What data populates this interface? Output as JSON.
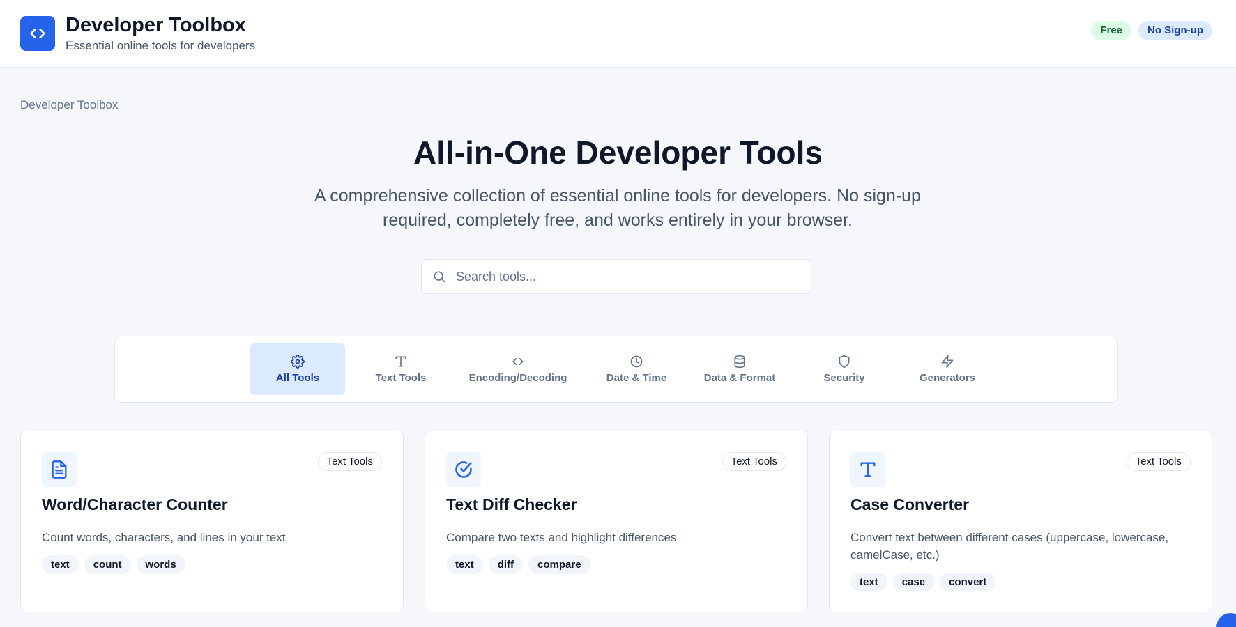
{
  "header": {
    "title": "Developer Toolbox",
    "subtitle": "Essential online tools for developers",
    "logo_icon": "code-brackets-icon",
    "badges": {
      "free": "Free",
      "no_signup": "No Sign-up"
    }
  },
  "breadcrumb": "Developer Toolbox",
  "hero": {
    "title": "All-in-One Developer Tools",
    "description": "A comprehensive collection of essential online tools for developers. No sign-up required, completely free, and works entirely in your browser."
  },
  "search": {
    "placeholder": "Search tools...",
    "value": ""
  },
  "tabs": [
    {
      "label": "All Tools",
      "icon": "gear-icon",
      "active": true
    },
    {
      "label": "Text Tools",
      "icon": "type-icon",
      "active": false
    },
    {
      "label": "Encoding/Decoding",
      "icon": "code-icon",
      "active": false
    },
    {
      "label": "Date & Time",
      "icon": "clock-icon",
      "active": false
    },
    {
      "label": "Data & Format",
      "icon": "database-icon",
      "active": false
    },
    {
      "label": "Security",
      "icon": "shield-icon",
      "active": false
    },
    {
      "label": "Generators",
      "icon": "zap-icon",
      "active": false
    }
  ],
  "cards": [
    {
      "title": "Word/Character Counter",
      "category": "Text Tools",
      "description": "Count words, characters, and lines in your text",
      "icon": "file-text-icon",
      "tags": [
        "text",
        "count",
        "words"
      ]
    },
    {
      "title": "Text Diff Checker",
      "category": "Text Tools",
      "description": "Compare two texts and highlight differences",
      "icon": "check-circle-icon",
      "tags": [
        "text",
        "diff",
        "compare"
      ]
    },
    {
      "title": "Case Converter",
      "category": "Text Tools",
      "description": "Convert text between different cases (uppercase, lowercase, camelCase, etc.)",
      "icon": "type-icon",
      "tags": [
        "text",
        "case",
        "convert"
      ]
    }
  ],
  "colors": {
    "accent": "#2563eb",
    "active_tab_bg": "#dbeafe",
    "free_badge": "#dcfce7"
  }
}
